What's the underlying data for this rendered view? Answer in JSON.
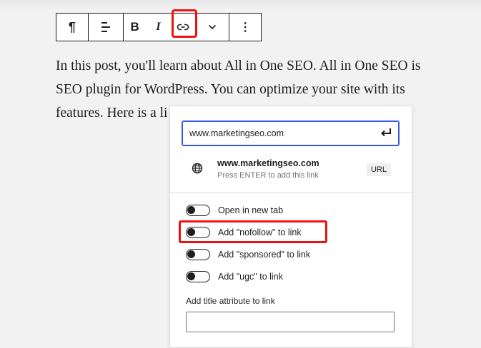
{
  "toolbar": {
    "paragraph_glyph": "¶",
    "bold_label": "B",
    "italic_label": "I",
    "more_options_glyph": "⋮"
  },
  "paragraph": {
    "lines": [
      "In this post, you'll learn about All in One SEO. All in One SEO is",
      "SEO plugin for WordPress. You can optimize your site with its",
      "features. Here is a li"
    ]
  },
  "link_popover": {
    "url_value": "www.marketingseo.com",
    "suggestion": {
      "title": "www.marketingseo.com",
      "hint": "Press ENTER to add this link",
      "badge": "URL"
    },
    "toggles": [
      {
        "label": "Open in new tab",
        "checked": false
      },
      {
        "label": "Add \"nofollow\" to link",
        "checked": false
      },
      {
        "label": "Add \"sponsored\" to link",
        "checked": false
      },
      {
        "label": "Add \"ugc\" to link",
        "checked": false
      }
    ],
    "title_attribute_label": "Add title attribute to link",
    "title_attribute_value": ""
  },
  "colors": {
    "highlight": "#ee1111",
    "focus": "#3858e9",
    "text": "#1e1e1e"
  },
  "icons": [
    "paragraph-icon",
    "align-icon",
    "link-icon",
    "chevron-down-icon",
    "more-options-icon",
    "enter-icon",
    "globe-icon"
  ]
}
